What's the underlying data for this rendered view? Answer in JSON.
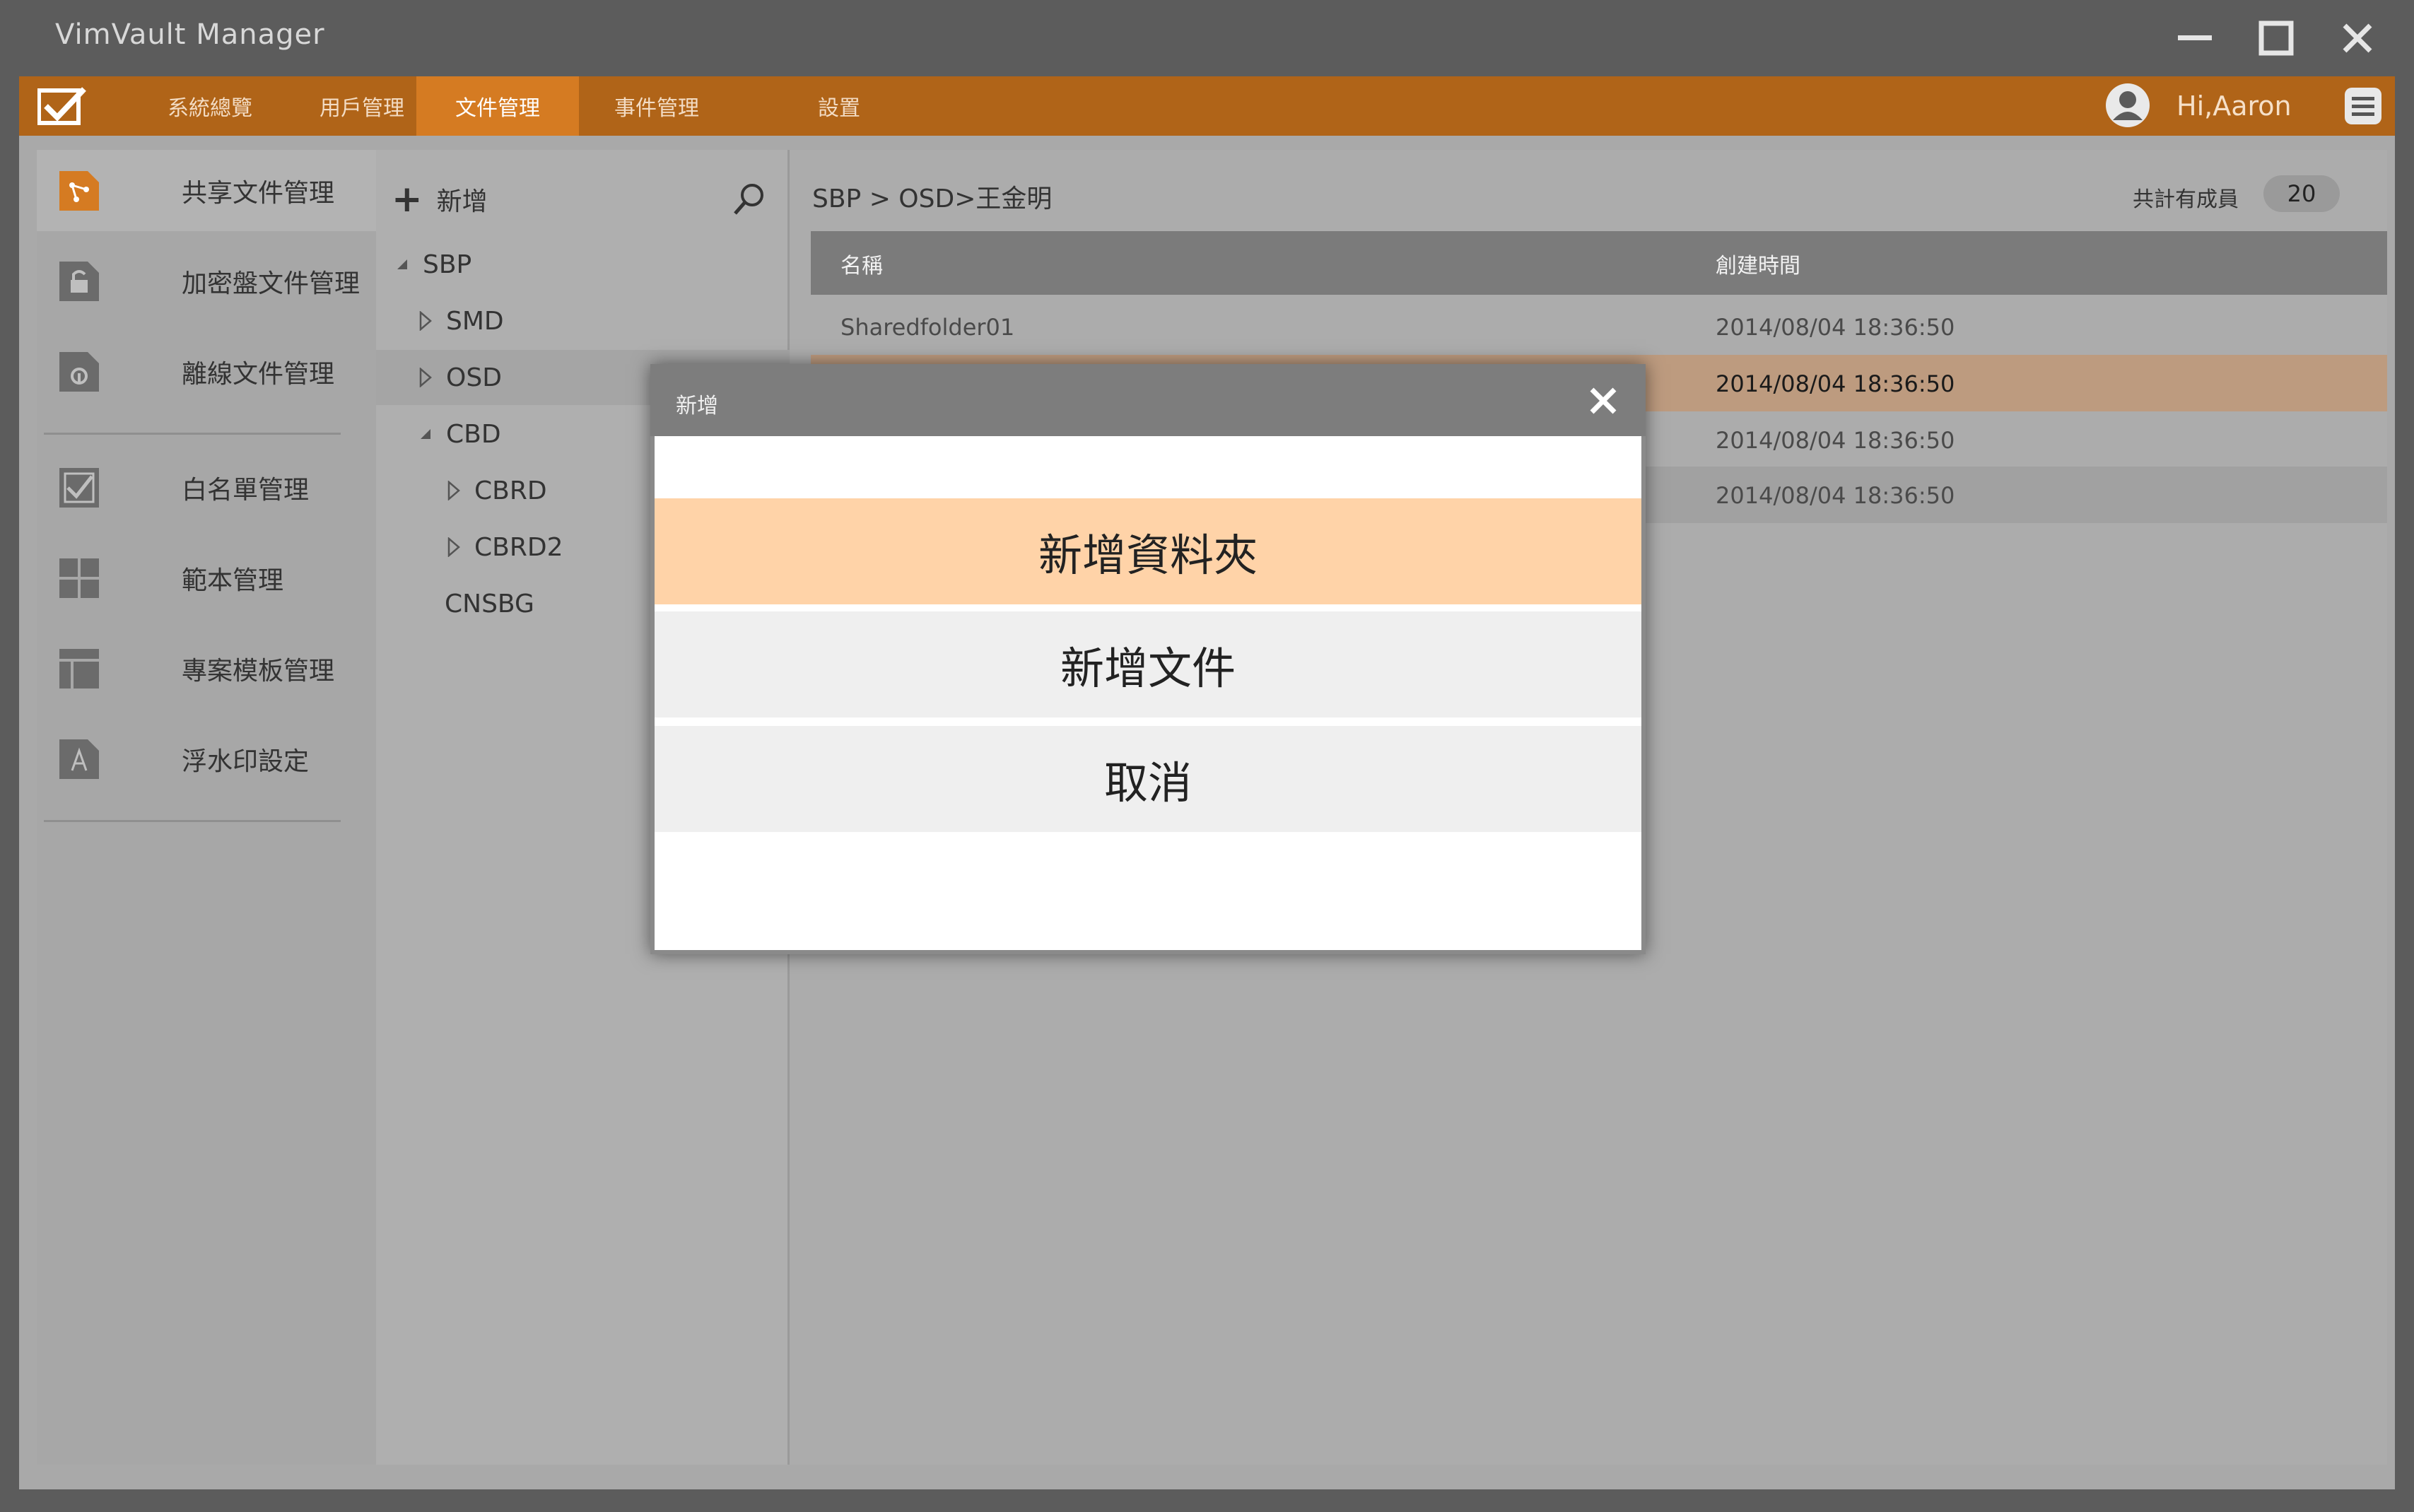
{
  "window": {
    "title": "VimVault Manager"
  },
  "colors": {
    "brand": "#b06418",
    "tab_active": "#d57b22",
    "highlight": "#ffd3a8",
    "row_highlight": "#bd9b7f"
  },
  "nav": {
    "tabs": [
      {
        "label": "系統總覽"
      },
      {
        "label": "用戶管理"
      },
      {
        "label": "文件管理"
      },
      {
        "label": "事件管理"
      },
      {
        "label": "設置"
      }
    ],
    "active_tab": "文件管理",
    "user_greeting": "Hi,Aaron"
  },
  "sidebar": {
    "items": [
      {
        "label": "共享文件管理",
        "icon": "share-icon"
      },
      {
        "label": "加密盤文件管理",
        "icon": "lock-icon"
      },
      {
        "label": "離線文件管理",
        "icon": "offline-icon"
      },
      {
        "label": "白名單管理",
        "icon": "checkbox-icon"
      },
      {
        "label": "範本管理",
        "icon": "grid-icon"
      },
      {
        "label": "專案模板管理",
        "icon": "layout-icon"
      },
      {
        "label": "浮水印設定",
        "icon": "watermark-icon"
      }
    ]
  },
  "tree": {
    "add_label": "新增",
    "nodes": [
      {
        "label": "SBP"
      },
      {
        "label": "SMD"
      },
      {
        "label": "OSD"
      },
      {
        "label": "CBD"
      },
      {
        "label": "CBRD"
      },
      {
        "label": "CBRD2"
      },
      {
        "label": "CNSBG"
      }
    ]
  },
  "main": {
    "breadcrumb": "SBP > OSD>王金明",
    "member_label": "共計有成員",
    "member_count": "20",
    "columns": {
      "name": "名稱",
      "created": "創建時間"
    },
    "rows": [
      {
        "name": "Sharedfolder01",
        "created": "2014/08/04 18:36:50"
      },
      {
        "name": "",
        "created": "2014/08/04 18:36:50"
      },
      {
        "name": "",
        "created": "2014/08/04 18:36:50"
      },
      {
        "name": "",
        "created": "2014/08/04 18:36:50"
      }
    ]
  },
  "modal": {
    "title": "新增",
    "options": {
      "new_folder": "新增資料夾",
      "new_file": "新增文件",
      "cancel": "取消"
    }
  }
}
